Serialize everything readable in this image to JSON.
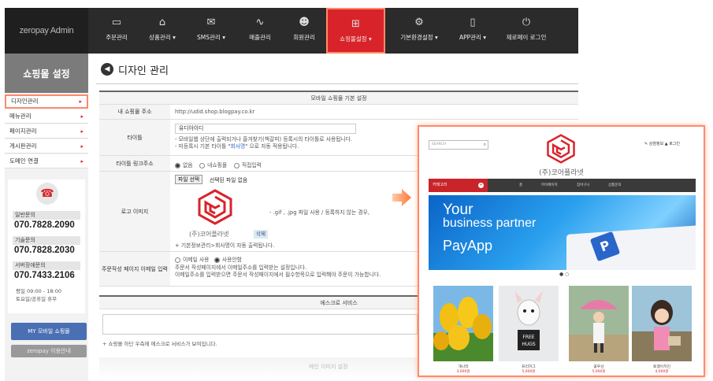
{
  "app": {
    "logo": "zeropay Admin"
  },
  "topnav": [
    {
      "label": "주문관리",
      "icon": "monitor-icon",
      "glyph": "▭"
    },
    {
      "label": "상품관리 ▾",
      "icon": "basket-icon",
      "glyph": "⌂"
    },
    {
      "label": "SMS관리 ▾",
      "icon": "chat-icon",
      "glyph": "✉"
    },
    {
      "label": "매출관리",
      "icon": "chart-icon",
      "glyph": "∿"
    },
    {
      "label": "회원관리",
      "icon": "users-icon",
      "glyph": "☻"
    },
    {
      "label": "쇼핑몰설정 ▾",
      "icon": "cart-icon",
      "glyph": "⊞"
    },
    {
      "label": "기본환경설정 ▾",
      "icon": "gear-icon",
      "glyph": "⚙"
    },
    {
      "label": "APP관리 ▾",
      "icon": "phone-icon",
      "glyph": "▯"
    },
    {
      "label": "제로페이 로그인",
      "icon": "power-icon",
      "glyph": "⏻"
    }
  ],
  "sidebar": {
    "title": "쇼핑몰 설정",
    "items": [
      {
        "label": "디자인관리"
      },
      {
        "label": "메뉴관리"
      },
      {
        "label": "페이지관리"
      },
      {
        "label": "게시판관리"
      },
      {
        "label": "도메인 연결"
      }
    ],
    "contact": [
      {
        "label": "일반문의",
        "number": "070.7828.2090"
      },
      {
        "label": "기술문의",
        "number": "070.7828.2030"
      },
      {
        "label": "서버장애문의",
        "number": "070.7433.2106"
      }
    ],
    "hours1": "평일 09:00 - 18:00",
    "hours2": "토요일/공휴일 휴무",
    "my_mobile": "MY 모바일 쇼핑몰",
    "zero_info": "zeropay 이용안내"
  },
  "main": {
    "title": "디자인 관리",
    "section_title": "모바일 쇼핑몰 기본 설정",
    "address_label": "내 쇼핑몰 주소",
    "address_value": "http://udid.shop.blogpay.co.kr",
    "title_label": "타이틀",
    "title_value": "유디아이디",
    "title_note1": "- 모바일웹 상단에 출력되거나 즐겨찾기(책갈피) 등록시의 타이틀로 사용됩니다.",
    "title_note2_pre": "- 미등록시 기본 타이틀 \"",
    "title_note2_hl": "회사명",
    "title_note2_post": "\" 으로 자동 적용됩니다.",
    "link_label": "타이틀 링크주소",
    "link_options": [
      "없음",
      "내쇼핑몰",
      "직접입력"
    ],
    "logo_label": "로고 이미지",
    "file_button": "파일 선택",
    "file_status": "선택된 파일 없음",
    "logo_caption": "(주)코어플라넷",
    "delete_button": "삭제",
    "logo_format_note": "- .gif , .jpg 파일 사용 / 등록하지 않는 경우,",
    "logo_default_note": "+ 기본정보관리>회사명이 자동 출력됩니다.",
    "email_label": "주문작성 페이지 이메일 입력",
    "email_options": [
      "이메일 사용",
      "사용안함"
    ],
    "email_note1": "주문서 작성페이지에서 이메일주소를 입력받는 설정입니다.",
    "email_note2": "이메일주소를 입력받으면 주문서 작성페이지에서 필수항목으로 입력해야 주문이 가능합니다.",
    "escrow_title": "에스크로 서비스",
    "escrow_note": "+ 쇼핑몰 하단 우측에 에스크로 서비스가 보여집니다.",
    "faded_text": "메인 이미지 설정"
  },
  "preview": {
    "search_placeholder": "SEARCH",
    "top_links": "✎ 상점정보   ▲ 로그인",
    "company": "(주)코어플라넷",
    "category": "카테고리",
    "nav": [
      "홈",
      "마이페이지",
      "장바구니",
      "상품문의"
    ],
    "banner_line1": "Your",
    "banner_line2": "business partner",
    "banner_line3": "PayApp",
    "banner_dots": "● ○",
    "products": [
      {
        "name": "개나리",
        "price": "3,000원"
      },
      {
        "name": "프리허그",
        "price": "5,000원"
      },
      {
        "name": "꽃우산",
        "price": "5,000원"
      },
      {
        "name": "토깽이치킨",
        "price": "4,000원"
      }
    ]
  },
  "colors": {
    "accent": "#d9232a",
    "highlight_border": "#ff8a6a",
    "topbar": "#2b2b2b"
  }
}
